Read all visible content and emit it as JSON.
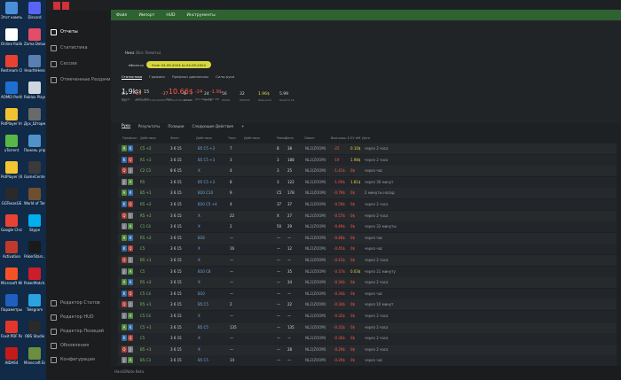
{
  "desktop_icons": [
    {
      "label": "Этот компьютер",
      "color": "#4a90d9"
    },
    {
      "label": "Discord",
      "color": "#5865f2"
    },
    {
      "label": "Online Radio.amp.",
      "color": "#ffffff"
    },
    {
      "label": "Zoma Deluxe",
      "color": "#e34d67"
    },
    {
      "label": "Restream Chat",
      "color": "#e8412f"
    },
    {
      "label": "HearthHero",
      "color": "#5a7fb0"
    },
    {
      "label": "AOMEI Partiti..",
      "color": "#1f6fd1"
    },
    {
      "label": "Roblox Player",
      "color": "#d0d6de"
    },
    {
      "label": "PotPlayer Image Viewer",
      "color": "#f1c232"
    },
    {
      "label": "Дух_Шторм..",
      "color": "#6a6a6a"
    },
    {
      "label": "uTorrent",
      "color": "#57b847"
    },
    {
      "label": "Панель управления",
      "color": "#4f93c9"
    },
    {
      "label": "PotPlayer (64-bit)",
      "color": "#f3c531"
    },
    {
      "label": "GameCenter",
      "color": "#3a3a3a"
    },
    {
      "label": "GGTexasGE",
      "color": "#2a2a2a"
    },
    {
      "label": "World of Tanks EU",
      "color": "#6f4f2e"
    },
    {
      "label": "Google Chrome",
      "color": "#e94235"
    },
    {
      "label": "Skype",
      "color": "#00aff0"
    },
    {
      "label": "Activation",
      "color": "#c0392b"
    },
    {
      "label": "PokerStars..",
      "color": "#1a1a1a"
    },
    {
      "label": "Microsoft Windows",
      "color": "#f35325"
    },
    {
      "label": "PokerMatch..",
      "color": "#cc1d2b"
    },
    {
      "label": "Параметры",
      "color": "#1f5fbf"
    },
    {
      "label": "Telegram",
      "color": "#2aa3e0"
    },
    {
      "label": "Foxit PDF Reader",
      "color": "#e2362d"
    },
    {
      "label": "OBS Studio",
      "color": "#2a2a2a"
    },
    {
      "label": "AIDA64",
      "color": "#c41a1a"
    },
    {
      "label": "Minecraft Education",
      "color": "#6b8e3f"
    }
  ],
  "sidebar": {
    "items": [
      {
        "label": "Отчеты",
        "active": true
      },
      {
        "label": "Статистика",
        "active": false
      },
      {
        "label": "Сессии",
        "active": false
      },
      {
        "label": "Отмеченные Раздачи",
        "active": false
      }
    ],
    "bottom": [
      {
        "label": "Редактор Статов"
      },
      {
        "label": "Редактор HUD"
      },
      {
        "label": "Редактор Позиций"
      },
      {
        "label": "Обновления"
      },
      {
        "label": "Конфигурация"
      }
    ]
  },
  "menu": [
    "Файл",
    "Импорт",
    "HUD",
    "Инструменты"
  ],
  "path": {
    "player": "Ника",
    "sub": "(Все Лимиты)"
  },
  "filter_label": "Фильтр",
  "date_range": "From 04-09-2024 to 04-09-2024",
  "report_tabs": [
    {
      "label": "Статистика",
      "on": true
    },
    {
      "label": "Графики",
      "on": false
    },
    {
      "label": "Префлоп диапазоны",
      "on": false
    },
    {
      "label": "Силы руки",
      "on": false
    }
  ],
  "stats_row1": [
    {
      "value": "1.9k",
      "label": "Hands",
      "color": "#e7eaee",
      "big": true
    },
    {
      "value": "19",
      "label": "VPIP",
      "color": "#d1d5d9"
    },
    {
      "value": "15",
      "label": "PFR",
      "color": "#d1d5d9"
    },
    {
      "value": "-10.66$",
      "label": "Won",
      "color": "#ff5a4d",
      "big": true
    },
    {
      "value": "-24",
      "label": "Win Rate EV",
      "color": "#ff5a4d"
    },
    {
      "value": "-1.9$",
      "label": "EV diff",
      "color": "#ff5a4d"
    }
  ],
  "stats_row2": [
    {
      "value": "4.1",
      "label": "Agg",
      "color": "#d1d5d9"
    },
    {
      "value": "-29",
      "label": "Win Rate EV bb/100",
      "color": "#ff7a55"
    },
    {
      "value": "-37",
      "label": "Win Without Showdown",
      "color": "#ff7a55"
    },
    {
      "value": "8",
      "label": "WTSD",
      "color": "#d1d5d9"
    },
    {
      "value": "24",
      "label": "WTSD",
      "color": "#d1d5d9"
    },
    {
      "value": "56",
      "label": "W$SD",
      "color": "#d1d5d9"
    },
    {
      "value": "32",
      "label": "W$WSF",
      "color": "#d1d5d9"
    },
    {
      "value": "1.96$",
      "label": "Rake paid",
      "color": "#e8d63a"
    },
    {
      "value": "5.99",
      "label": "Dealt to bb",
      "color": "#d1d5d9"
    }
  ],
  "table_tabs": [
    {
      "label": "Руки",
      "on": true
    },
    {
      "label": "Результаты",
      "on": false
    },
    {
      "label": "Позиции",
      "on": false
    },
    {
      "label": "Следующие Действия",
      "on": false
    },
    {
      "label": "+",
      "on": false
    }
  ],
  "columns": [
    "Префлоп",
    "Действия",
    "Флоп",
    "Действия",
    "Терн",
    "Действия",
    "Ривер",
    "Банк",
    "Лимит",
    "Выигрыш $",
    "EV diff",
    "Дата"
  ],
  "rows": [
    {
      "pos": "B5",
      "act": "C5 +2",
      "flop": "3 6 15",
      "board": "B5 C5 +3",
      "turn": "7",
      "bank": "38",
      "river": "8",
      "win": "-25",
      "win_c": "#ff5a4d",
      "ev": "0.10$",
      "ev_c": "#e8d63a",
      "date": "через 2 часа"
    },
    {
      "pos": "B5",
      "act": "R5 +2",
      "flop": "3 6 15",
      "board": "B5 C5 +3",
      "turn": "3",
      "bank": "188",
      "river": "3",
      "win": "-19",
      "win_c": "#ff5a4d",
      "ev": "1.98$",
      "ev_c": "#e8d63a",
      "date": "через 2 часа"
    },
    {
      "pos": "C2",
      "act": "C2 C3",
      "flop": "8 6 15",
      "board": "X",
      "turn": "4",
      "bank": "25",
      "river": "3",
      "win": "-1.41$",
      "win_c": "#ff5a4d",
      "ev": "0$",
      "ev_c": "#ff5a4d",
      "date": "через час"
    },
    {
      "pos": "B5",
      "act": "R5",
      "flop": "3 6 15",
      "board": "B5 C5 +3",
      "turn": "8",
      "bank": "122",
      "river": "3",
      "win": "-1.09$",
      "win_c": "#ff5a4d",
      "ev": "1.81$",
      "ev_c": "#e8d63a",
      "date": "через 36 минут"
    },
    {
      "pos": "B5",
      "act": "B5 +1",
      "flop": "3 6 15",
      "board": "B10 C10",
      "turn": "9",
      "bank": "178",
      "river": "C5",
      "win": "-0.79$",
      "win_c": "#ff5a4d",
      "ev": "0$",
      "ev_c": "#ff5a4d",
      "date": "2 минуты назад"
    },
    {
      "pos": "B5",
      "act": "R5 +2",
      "flop": "3 6 15",
      "board": "B10 C5 +4",
      "turn": "4",
      "bank": "37",
      "river": "37",
      "win": "-0.59$",
      "win_c": "#ff5a4d",
      "ev": "0$",
      "ev_c": "#ff5a4d",
      "date": "через 2 часа"
    },
    {
      "pos": "B5",
      "act": "R5 +2",
      "flop": "3 6 15",
      "board": "X",
      "turn": "22",
      "bank": "27",
      "river": "X",
      "win": "-0.57$",
      "win_c": "#ff5a4d",
      "ev": "0$",
      "ev_c": "#ff5a4d",
      "date": "через 2 часа"
    },
    {
      "pos": "C1",
      "act": "C1 C4",
      "flop": "3 6 15",
      "board": "X",
      "turn": "2",
      "bank": "29",
      "river": "50",
      "win": "-0.49$",
      "win_c": "#ff5a4d",
      "ev": "0$",
      "ev_c": "#ff5a4d",
      "date": "через 33 минуты"
    },
    {
      "pos": "R5",
      "act": "R5 +2",
      "flop": "3 6 15",
      "board": "B16",
      "turn": "—",
      "bank": "—",
      "river": "—",
      "win": "-0.48$",
      "win_c": "#ff5a4d",
      "ev": "0$",
      "ev_c": "#ff5a4d",
      "date": "через час"
    },
    {
      "pos": "B5",
      "act": "C5",
      "flop": "3 6 15",
      "board": "X",
      "turn": "16",
      "bank": "12",
      "river": "—",
      "win": "-0.45$",
      "win_c": "#ff5a4d",
      "ev": "0$",
      "ev_c": "#ff5a4d",
      "date": "через час"
    },
    {
      "pos": "B5",
      "act": "B5 +1",
      "flop": "3 6 15",
      "board": "X",
      "turn": "—",
      "bank": "—",
      "river": "—",
      "win": "-0.41$",
      "win_c": "#ff5a4d",
      "ev": "0$",
      "ev_c": "#ff5a4d",
      "date": "через 2 часа"
    },
    {
      "pos": "R5",
      "act": "C5",
      "flop": "3 6 15",
      "board": "B10 C8",
      "turn": "—",
      "bank": "35",
      "river": "—",
      "win": "-0.37$",
      "win_c": "#ff5a4d",
      "ev": "0.03$",
      "ev_c": "#e8d63a",
      "date": "через 21 минуту"
    },
    {
      "pos": "B5",
      "act": "R5 +2",
      "flop": "3 6 15",
      "board": "X",
      "turn": "—",
      "bank": "34",
      "river": "—",
      "win": "-0.34$",
      "win_c": "#ff5a4d",
      "ev": "0$",
      "ev_c": "#ff5a4d",
      "date": "через 2 часа"
    },
    {
      "pos": "B5",
      "act": "C5 C4",
      "flop": "3 6 15",
      "board": "B10",
      "turn": "—",
      "bank": "—",
      "river": "—",
      "win": "-0.34$",
      "win_c": "#ff5a4d",
      "ev": "0$",
      "ev_c": "#ff5a4d",
      "date": "через час"
    },
    {
      "pos": "B5",
      "act": "R5 +1",
      "flop": "3 6 15",
      "board": "B5 C5",
      "turn": "2",
      "bank": "22",
      "river": "—",
      "win": "-0.34$",
      "win_c": "#ff5a4d",
      "ev": "0$",
      "ev_c": "#ff5a4d",
      "date": "через 10 минут"
    },
    {
      "pos": "B5",
      "act": "C5 C4",
      "flop": "3 6 15",
      "board": "X",
      "turn": "—",
      "bank": "—",
      "river": "—",
      "win": "-0.32$",
      "win_c": "#ff5a4d",
      "ev": "0$",
      "ev_c": "#ff5a4d",
      "date": "через 2 часа"
    },
    {
      "pos": "B5",
      "act": "C5 +1",
      "flop": "3 6 15",
      "board": "B5 C5",
      "turn": "135",
      "bank": "135",
      "river": "—",
      "win": "-0.32$",
      "win_c": "#ff5a4d",
      "ev": "0$",
      "ev_c": "#ff5a4d",
      "date": "через 2 часа"
    },
    {
      "pos": "B5",
      "act": "C5",
      "flop": "3 6 15",
      "board": "X",
      "turn": "—",
      "bank": "—",
      "river": "—",
      "win": "-0.30$",
      "win_c": "#ff5a4d",
      "ev": "0$",
      "ev_c": "#ff5a4d",
      "date": "через 2 часа"
    },
    {
      "pos": "B5",
      "act": "B5 +1",
      "flop": "3 6 15",
      "board": "X",
      "turn": "—",
      "bank": "28",
      "river": "—",
      "win": "-0.29$",
      "win_c": "#ff5a4d",
      "ev": "0$",
      "ev_c": "#ff5a4d",
      "date": "через 2 часа"
    },
    {
      "pos": "B5",
      "act": "B5 C3",
      "flop": "3 6 15",
      "board": "B5 C5",
      "turn": "14",
      "bank": "—",
      "river": "—",
      "win": "-0.29$",
      "win_c": "#ff5a4d",
      "ev": "0$",
      "ev_c": "#ff5a4d",
      "date": "через час"
    }
  ],
  "limit_label": "NL2(ZOOM)",
  "status": "Hand2Note Beta",
  "colors": {
    "accent": "#2f6231",
    "date_pill": "#d8d83e",
    "neg": "#ff5a4d",
    "pos": "#e8d63a"
  }
}
